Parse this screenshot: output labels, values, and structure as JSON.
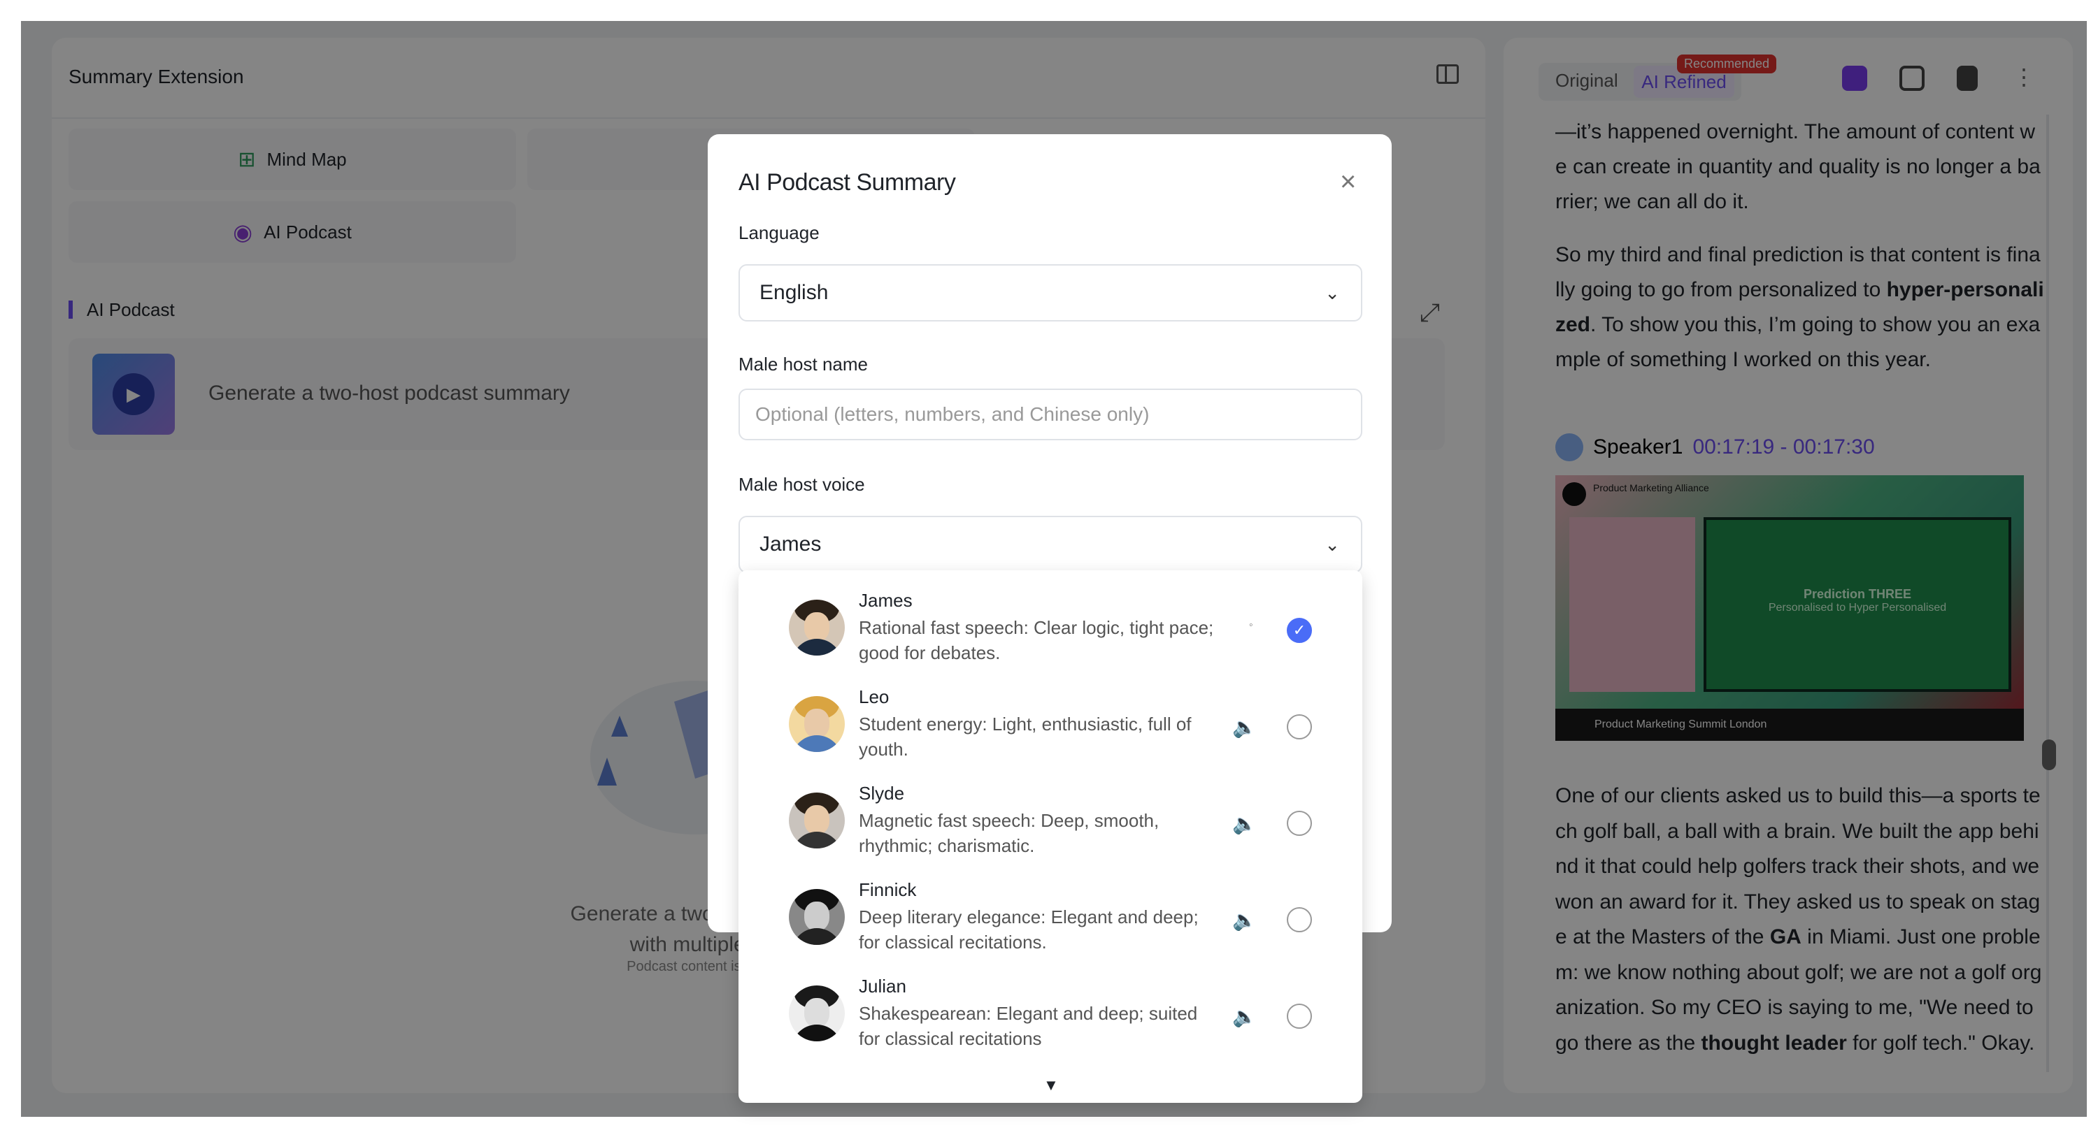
{
  "left_panel": {
    "title": "Summary Extension",
    "tools": [
      {
        "label": "Mind Map",
        "icon": "mind-map-icon"
      },
      {
        "label": "AI Podcast",
        "icon": "podcast-icon"
      }
    ],
    "section_title": "AI Podcast",
    "generate_card_text": "Generate a two-host podcast summary",
    "empty_text_line1": "Generate a two-host podcas",
    "empty_text_line2": "with multiple ho",
    "empty_note": "Podcast content is AI-ge"
  },
  "right_panel": {
    "tabs": {
      "original": "Original",
      "refined": "AI Refined"
    },
    "badge": "Recommended",
    "transcript_top": "—it’s happened overnight. The amount of content we can create in quantity and quality is no longer a barrier; we can all do it.",
    "transcript_p2_a": "So my third and final prediction is that content is finally going to go from personalized to ",
    "transcript_p2_bold": "hyper-personalized",
    "transcript_p2_b": ". To show you this, I’m going to show you an example of something I worked on this year.",
    "speaker_name": "Speaker1",
    "speaker_time": "00:17:19 - 00:17:30",
    "video": {
      "brand": "Product Marketing Alliance",
      "screen_title": "Prediction THREE",
      "screen_sub": "Personalised to Hyper Personalised",
      "bar_text": "Product Marketing Summit London"
    },
    "transcript_bottom_a": "One of our clients asked us to build this—a sports tech golf ball, a ball with a brain. We built the app behind it that could help golfers track their shots, and we won an award for it. They asked us to speak on stage at the Masters of the ",
    "transcript_bottom_bold1": "GA",
    "transcript_bottom_b": " in Miami. Just one problem: we know nothing about golf; we are not a golf organization. So my CEO is saying to me, \"We need to go there as the ",
    "transcript_bottom_bold2": "thought leader",
    "transcript_bottom_c": " for golf tech.\" Okay."
  },
  "modal": {
    "title": "AI Podcast Summary",
    "language_label": "Language",
    "language_value": "English",
    "male_host_name_label": "Male host name",
    "male_host_name_placeholder": "Optional (letters, numbers, and Chinese only)",
    "male_host_voice_label": "Male host voice",
    "male_host_voice_value": "James",
    "voices": [
      {
        "name": "James",
        "desc": "Rational fast speech: Clear logic, tight pace; good for debates.",
        "selected": true
      },
      {
        "name": "Leo",
        "desc": "Student energy: Light, enthusiastic, full of youth.",
        "selected": false
      },
      {
        "name": "Slyde",
        "desc": "Magnetic fast speech: Deep, smooth, rhythmic; charismatic.",
        "selected": false
      },
      {
        "name": "Finnick",
        "desc": "Deep literary elegance: Elegant and deep; for classical recitations.",
        "selected": false
      },
      {
        "name": "Julian",
        "desc": "Shakespearean: Elegant and deep; suited for classical recitations",
        "selected": false
      }
    ]
  },
  "colors": {
    "accent": "#6b4ef2",
    "check": "#4a6cf7",
    "badge": "#e0322f"
  }
}
